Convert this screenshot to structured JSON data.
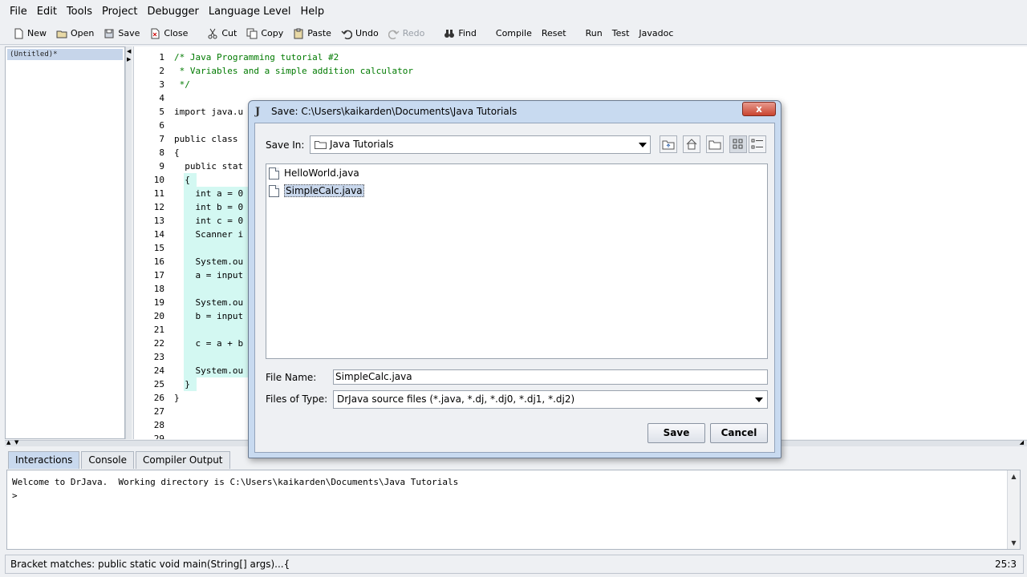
{
  "menu": [
    "File",
    "Edit",
    "Tools",
    "Project",
    "Debugger",
    "Language Level",
    "Help"
  ],
  "toolbar": {
    "new": "New",
    "open": "Open",
    "save": "Save",
    "close": "Close",
    "cut": "Cut",
    "copy": "Copy",
    "paste": "Paste",
    "undo": "Undo",
    "redo": "Redo",
    "find": "Find",
    "compile": "Compile",
    "reset": "Reset",
    "run": "Run",
    "test": "Test",
    "javadoc": "Javadoc"
  },
  "documents": [
    "(Untitled)*"
  ],
  "editor": {
    "lines": [
      {
        "n": "1",
        "code": "/* Java Programming tutorial #2"
      },
      {
        "n": "2",
        "code": " * Variables and a simple addition calculator"
      },
      {
        "n": "3",
        "code": " */"
      },
      {
        "n": "4",
        "code": ""
      },
      {
        "n": "5",
        "code": "import java.u"
      },
      {
        "n": "6",
        "code": ""
      },
      {
        "n": "7",
        "code": "public class"
      },
      {
        "n": "8",
        "code": "{"
      },
      {
        "n": "9",
        "code": "  public stat"
      },
      {
        "n": "10",
        "code": "  {"
      },
      {
        "n": "11",
        "code": "    int a = 0"
      },
      {
        "n": "12",
        "code": "    int b = 0"
      },
      {
        "n": "13",
        "code": "    int c = 0"
      },
      {
        "n": "14",
        "code": "    Scanner i"
      },
      {
        "n": "15",
        "code": ""
      },
      {
        "n": "16",
        "code": "    System.ou"
      },
      {
        "n": "17",
        "code": "    a = input"
      },
      {
        "n": "18",
        "code": ""
      },
      {
        "n": "19",
        "code": "    System.ou"
      },
      {
        "n": "20",
        "code": "    b = input"
      },
      {
        "n": "21",
        "code": ""
      },
      {
        "n": "22",
        "code": "    c = a + b"
      },
      {
        "n": "23",
        "code": ""
      },
      {
        "n": "24",
        "code": "    System.ou"
      },
      {
        "n": "25",
        "code": "  }"
      },
      {
        "n": "26",
        "code": "}"
      },
      {
        "n": "27",
        "code": ""
      },
      {
        "n": "28",
        "code": ""
      },
      {
        "n": "29",
        "code": ""
      }
    ]
  },
  "tabs": [
    "Interactions",
    "Console",
    "Compiler Output"
  ],
  "interactions": {
    "welcome": "Welcome to DrJava.  Working directory is C:\\Users\\kaikarden\\Documents\\Java Tutorials",
    "prompt": ">"
  },
  "status": {
    "bracket": "Bracket matches:   public static void main(String[] args)...{",
    "position": "25:3"
  },
  "dialog": {
    "title": "Save:  C:\\Users\\kaikarden\\Documents\\Java Tutorials",
    "save_in_label": "Save In:",
    "save_in_value": "Java Tutorials",
    "files": [
      "HelloWorld.java",
      "SimpleCalc.java"
    ],
    "selected_file": "SimpleCalc.java",
    "file_name_label": "File Name:",
    "file_name_value": "SimpleCalc.java",
    "files_of_type_label": "Files of Type:",
    "files_of_type_value": "DrJava source files (*.java, *.dj, *.dj0, *.dj1, *.dj2)",
    "save_button": "Save",
    "cancel_button": "Cancel",
    "close_glyph": "x"
  }
}
